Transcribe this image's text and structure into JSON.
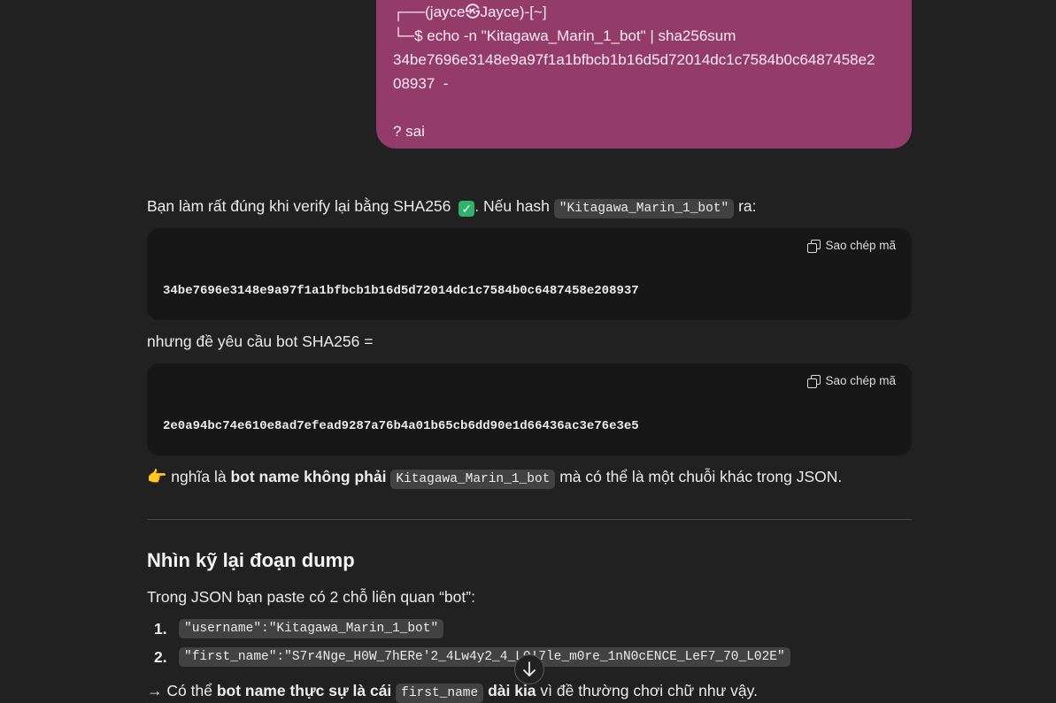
{
  "user_message": {
    "line_1": "┌──(jayce㉿Jayce)-[~]",
    "line_2": "└─$ echo -n \"Kitagawa_Marin_1_bot\" | sha256sum",
    "line_3": "34be7696e3148e9a97f1a1bfbcb1b16d5d72014dc1c7584b0c6487458e2",
    "line_4": "08937  -",
    "line_5": "",
    "line_6": "? sai"
  },
  "reply": {
    "p1_before": "Bạn làm rất đúng khi verify lại bằng SHA256",
    "p1_check_icon": "✓",
    "p1_mid": ". Nếu hash",
    "p1_code": "\"Kitagawa_Marin_1_bot\"",
    "p1_after": "ra:",
    "copy_label": "Sao chép mã",
    "code_1": "34be7696e3148e9a97f1a1bfbcb1b16d5d72014dc1c7584b0c6487458e208937",
    "p2": "nhưng đề yêu cầu bot SHA256 =",
    "code_2": "2e0a94bc74e610e8ad7efead9287a76b4a01b65cb6dd90e1d66436ac3e76e3e5",
    "p3_emoji": "👉",
    "p3_a": "nghĩa là",
    "p3_bold": "bot name không phải",
    "p3_code": "Kitagawa_Marin_1_bot",
    "p3_after": "mà có thể là một chuỗi khác trong JSON.",
    "heading": "Nhìn kỹ lại đoạn dump",
    "p4": "Trong JSON bạn paste có 2 chỗ liên quan “bot”:",
    "list": [
      {
        "num": "1.",
        "code": "\"username\":\"Kitagawa_Marin_1_bot\""
      },
      {
        "num": "2.",
        "code": "\"first_name\":\"S7r4Nge_H0W_7hERe'2_4Lw4y2_4_L0!7le_m0re_1nN0cENCE_LeF7_70_L02E\""
      }
    ],
    "p5_prefix": "→ Có thể",
    "p5_bold": "bot name thực sự là cái",
    "p5_code": "first_name",
    "p5_bold2": "dài kia",
    "p5_after": "vì đề thường chơi chữ như vậy."
  },
  "scroll_button_icon": "arrow-down-icon"
}
